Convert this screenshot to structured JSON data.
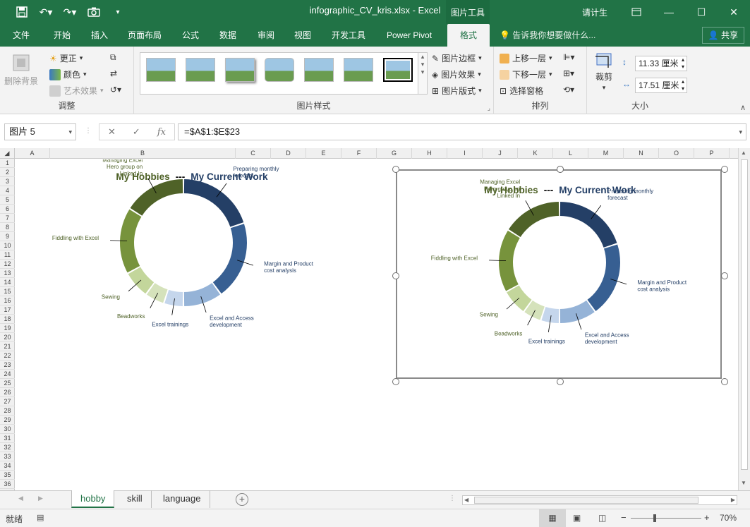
{
  "window": {
    "title": "infographic_CV_kris.xlsx - Excel",
    "context_tab": "图片工具",
    "user": "请计生",
    "share": "共享"
  },
  "tabs": [
    "文件",
    "开始",
    "插入",
    "页面布局",
    "公式",
    "数据",
    "审阅",
    "视图",
    "开发工具",
    "Power Pivot",
    "格式"
  ],
  "tellme": "告诉我你想要做什么...",
  "ribbon": {
    "adjust": {
      "remove_bg": "删除背景",
      "correct": "更正",
      "color": "颜色",
      "art": "艺术效果",
      "label": "调整"
    },
    "styles": {
      "border": "图片边框",
      "effect": "图片效果",
      "layout": "图片版式",
      "label": "图片样式"
    },
    "arrange": {
      "bring_forward": "上移一层",
      "send_backward": "下移一层",
      "selection_pane": "选择窗格",
      "label": "排列"
    },
    "size": {
      "crop": "裁剪",
      "height": "11.33 厘米",
      "width": "17.51 厘米",
      "label": "大小"
    }
  },
  "formula_bar": {
    "name_box": "图片 5",
    "formula": "=$A$1:$E$23"
  },
  "columns": [
    "A",
    "B",
    "C",
    "D",
    "E",
    "F",
    "G",
    "H",
    "I",
    "J",
    "K",
    "L",
    "M",
    "N",
    "O",
    "P"
  ],
  "rows": [
    "1",
    "2",
    "3",
    "4",
    "5",
    "6",
    "7",
    "8",
    "9",
    "10",
    "11",
    "12",
    "13",
    "14",
    "15",
    "16",
    "17",
    "18",
    "19",
    "20",
    "21",
    "22",
    "23",
    "24",
    "25",
    "26",
    "27",
    "28",
    "29",
    "30",
    "31",
    "32",
    "33",
    "34",
    "35",
    "36"
  ],
  "chart": {
    "title_left": "My Hobbies",
    "separator": "---",
    "title_right": "My Current Work",
    "colors": {
      "work": [
        "#243f66",
        "#375f92",
        "#95b3d7",
        "#c5d6ec"
      ],
      "hobby": [
        "#d5e2bb",
        "#c3d69b",
        "#77933c",
        "#4f6228"
      ],
      "title_left": "#4f6228",
      "title_right": "#243f66"
    },
    "slices": [
      {
        "label": "Preparing monthly forecast",
        "value": 20,
        "group": "work"
      },
      {
        "label": "Margin and Product cost analysis",
        "value": 20,
        "group": "work"
      },
      {
        "label": "Excel and Access development",
        "value": 10,
        "group": "work"
      },
      {
        "label": "Excel trainings",
        "value": 5,
        "group": "work"
      },
      {
        "label": "Beadworks",
        "value": 5,
        "group": "hobby"
      },
      {
        "label": "Sewing",
        "value": 7,
        "group": "hobby"
      },
      {
        "label": "Fiddling with Excel",
        "value": 17,
        "group": "hobby"
      },
      {
        "label": "Managing Excel Hero group on Linked In",
        "value": 16,
        "group": "hobby"
      }
    ],
    "label_lines": {
      "Preparing monthly forecast": [
        "Preparing monthly",
        "forecast"
      ],
      "Margin and Product cost analysis": [
        "Margin and Product",
        "cost analysis"
      ],
      "Excel and Access development": [
        "Excel and Access",
        "development"
      ],
      "Excel trainings": [
        "Excel trainings"
      ],
      "Beadworks": [
        "Beadworks"
      ],
      "Sewing": [
        "Sewing"
      ],
      "Fiddling with Excel": [
        "Fiddling with Excel"
      ],
      "Managing Excel Hero group on Linked In": [
        "Managing Excel",
        "Hero group on",
        "Linked In"
      ]
    }
  },
  "chart_data": {
    "type": "pie",
    "title": "My Hobbies --- My Current Work",
    "categories": [
      "Preparing monthly forecast",
      "Margin and Product cost analysis",
      "Excel and Access development",
      "Excel trainings",
      "Beadworks",
      "Sewing",
      "Fiddling with Excel",
      "Managing Excel Hero group on Linked In"
    ],
    "values": [
      20,
      20,
      10,
      5,
      5,
      7,
      17,
      16
    ]
  },
  "sheets": [
    "hobby",
    "skill",
    "language"
  ],
  "status": {
    "ready": "就绪",
    "zoom": "70%"
  }
}
